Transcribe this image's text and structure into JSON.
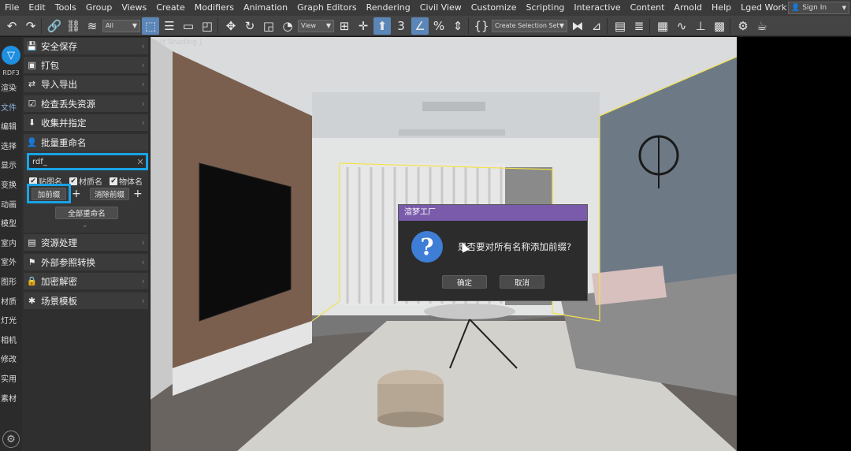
{
  "menubar": {
    "items": [
      "File",
      "Edit",
      "Tools",
      "Group",
      "Views",
      "Create",
      "Modifiers",
      "Animation",
      "Graph Editors",
      "Rendering",
      "Civil View",
      "Customize",
      "Scripting",
      "Interactive",
      "Content",
      "Arnold",
      "Help",
      "Lged Work"
    ],
    "signin_label": "Sign In"
  },
  "toolbar": {
    "filter_value": "All",
    "view_value": "View",
    "selection_set_value": "Create Selection Set"
  },
  "vtabs": {
    "brand": "RDF3",
    "items": [
      "渲染",
      "文件",
      "编辑",
      "选择",
      "显示",
      "变换",
      "动画",
      "模型",
      "室内",
      "室外",
      "图形",
      "材质",
      "灯光",
      "相机",
      "修改",
      "实用",
      "素材"
    ],
    "active": "文件"
  },
  "panel": {
    "sections_top": [
      "安全保存",
      "打包",
      "导入导出",
      "检查丢失资源",
      "收集并指定",
      "批量重命名"
    ],
    "sections_bottom": [
      "资源处理",
      "外部参照转换",
      "加密解密",
      "场景模板"
    ],
    "rename": {
      "prefix_value": "rdf_",
      "checks": [
        "贴图名",
        "材质名",
        "物体名"
      ],
      "add_prefix": "加前缀",
      "remove_prefix": "消除前缀",
      "rename_all": "全部重命名"
    }
  },
  "viewport": {
    "label": "ault Shading ]"
  },
  "dialog": {
    "title": "渲梦工厂",
    "message": "是否要对所有名称添加前缀?",
    "ok": "确定",
    "cancel": "取消"
  }
}
